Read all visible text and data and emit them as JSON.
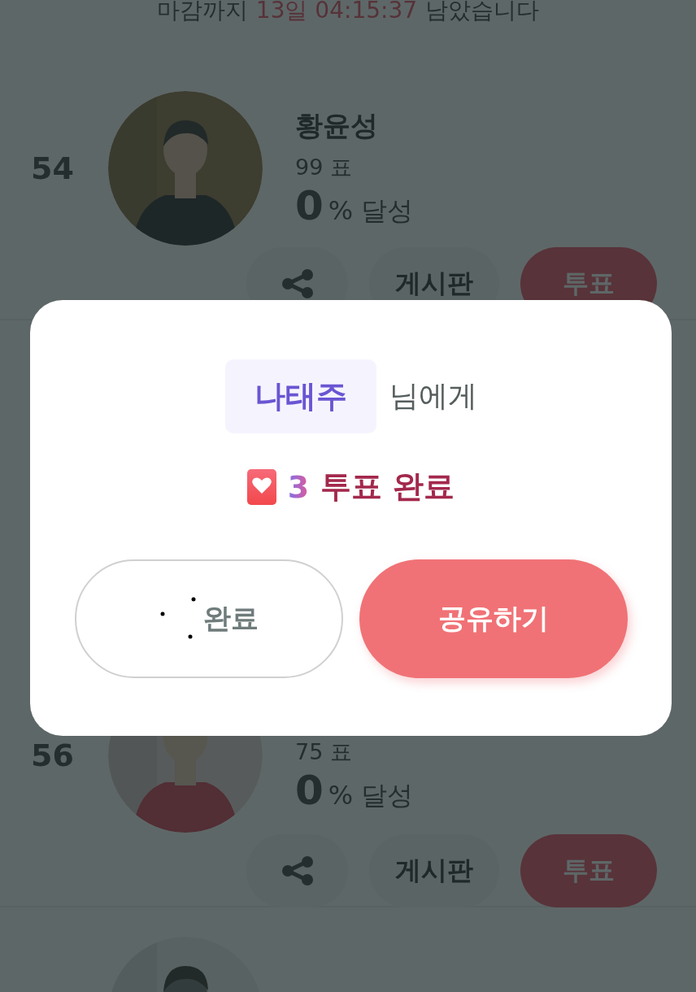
{
  "countdown": {
    "prefix": "마감까지",
    "time": "13일 04:15:37",
    "suffix": "남았습니다"
  },
  "candidates": [
    {
      "rank": "54",
      "name": "황윤성",
      "votes": "99 표",
      "percent": "0",
      "percent_label": "% 달성",
      "board_label": "게시판",
      "vote_label": "투표",
      "kind": "picture"
    },
    {
      "rank": "56",
      "votes": "75 표",
      "percent": "0",
      "percent_label": "% 달성",
      "board_label": "게시판",
      "vote_label": "투표",
      "kind": "picture"
    },
    {
      "kind": "picture"
    }
  ],
  "modal": {
    "recipient": "나태주",
    "recipient_suffix": "님에게",
    "count": "3",
    "result": "투표 완료",
    "done_label": "완료",
    "share_label": "공유하기"
  }
}
